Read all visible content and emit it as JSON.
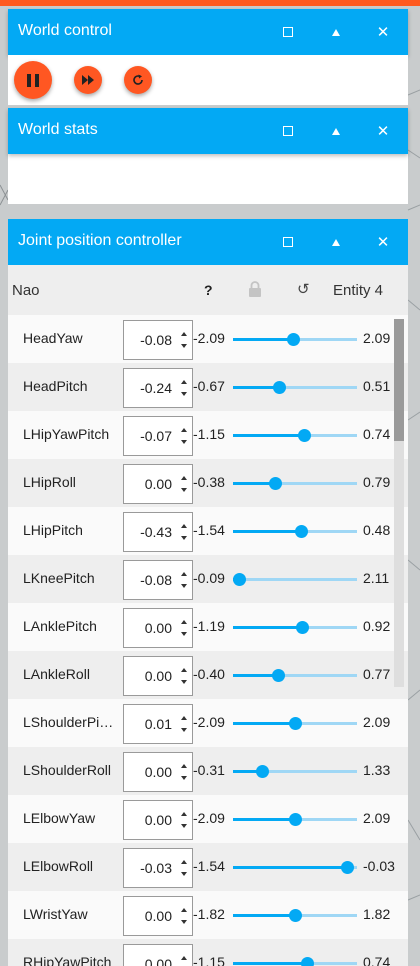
{
  "world_control": {
    "title": "World control",
    "icons": {
      "pause": "pause-icon",
      "step": "fast-forward-icon",
      "reset": "refresh-icon"
    }
  },
  "world_stats": {
    "title": "World stats"
  },
  "joint_controller": {
    "title": "Joint position controller",
    "model": "Nao",
    "help": "?",
    "entity": "Entity 4",
    "joints": [
      {
        "name": "HeadYaw",
        "value": "-0.08",
        "min": "-2.09",
        "max": "2.09",
        "fraction": 0.48
      },
      {
        "name": "HeadPitch",
        "value": "-0.24",
        "min": "-0.67",
        "max": "0.51",
        "fraction": 0.37
      },
      {
        "name": "LHipYawPitch",
        "value": "-0.07",
        "min": "-1.15",
        "max": "0.74",
        "fraction": 0.57
      },
      {
        "name": "LHipRoll",
        "value": "0.00",
        "min": "-0.38",
        "max": "0.79",
        "fraction": 0.34
      },
      {
        "name": "LHipPitch",
        "value": "-0.43",
        "min": "-1.54",
        "max": "0.48",
        "fraction": 0.55
      },
      {
        "name": "LKneePitch",
        "value": "-0.08",
        "min": "-0.09",
        "max": "2.11",
        "fraction": 0.05
      },
      {
        "name": "LAnklePitch",
        "value": "0.00",
        "min": "-1.19",
        "max": "0.92",
        "fraction": 0.56
      },
      {
        "name": "LAnkleRoll",
        "value": "0.00",
        "min": "-0.40",
        "max": "0.77",
        "fraction": 0.36
      },
      {
        "name": "LShoulderPi…",
        "value": "0.01",
        "min": "-2.09",
        "max": "2.09",
        "fraction": 0.5
      },
      {
        "name": "LShoulderRoll",
        "value": "0.00",
        "min": "-0.31",
        "max": "1.33",
        "fraction": 0.23
      },
      {
        "name": "LElbowYaw",
        "value": "0.00",
        "min": "-2.09",
        "max": "2.09",
        "fraction": 0.5
      },
      {
        "name": "LElbowRoll",
        "value": "-0.03",
        "min": "-1.54",
        "max": "-0.03",
        "fraction": 0.92
      },
      {
        "name": "LWristYaw",
        "value": "0.00",
        "min": "-1.82",
        "max": "1.82",
        "fraction": 0.5
      },
      {
        "name": "RHipYawPitch",
        "value": "0.00",
        "min": "-1.15",
        "max": "0.74",
        "fraction": 0.6
      }
    ]
  },
  "colors": {
    "header": "#03a9f4",
    "button": "#ff5722",
    "accent": "#03a9f4"
  }
}
